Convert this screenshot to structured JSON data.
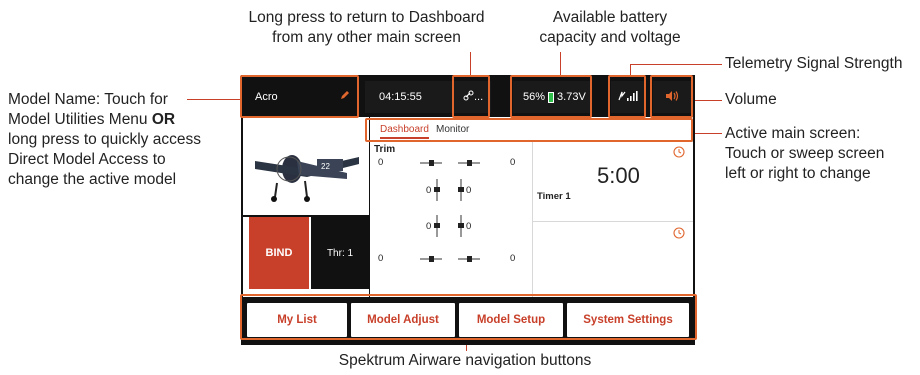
{
  "annotations": {
    "top_long_press": [
      "Long press to return to Dashboard",
      "from any other main screen"
    ],
    "top_battery": [
      "Available battery",
      "capacity and voltage"
    ],
    "telemetry": "Telemetry Signal Strength",
    "volume": "Volume",
    "model_name": [
      "Model Name: Touch for",
      "Model Utilities Menu",
      "OR",
      "long press to quickly access",
      "Direct Model Access to",
      "change the active model"
    ],
    "active_screen": [
      "Active main screen:",
      "Touch or sweep screen",
      "left or right to change"
    ],
    "nav_buttons": "Spektrum Airware navigation buttons"
  },
  "topbar": {
    "model_name": "Acro",
    "timer": "04:15:55",
    "link_text": "...",
    "battery_percent": "56%",
    "battery_voltage": "3.73V"
  },
  "tabs": [
    {
      "label": "Dashboard",
      "active": true
    },
    {
      "label": "Monitor",
      "active": false
    }
  ],
  "trim": {
    "title": "Trim",
    "left_top": "0",
    "right_top": "0",
    "left_bottom": "0",
    "right_bottom": "0",
    "center_top_left": "0",
    "center_top_right": "0",
    "center_bottom_left": "0",
    "center_bottom_right": "0"
  },
  "timer_panel": {
    "time": "5:00",
    "label": "Timer 1"
  },
  "bind_button": "BIND",
  "throttle": "Thr: 1",
  "nav": [
    "My List",
    "Model Adjust",
    "Model Setup",
    "System Settings"
  ],
  "colors": {
    "accent": "#e0662e",
    "bind": "#c8402a"
  }
}
